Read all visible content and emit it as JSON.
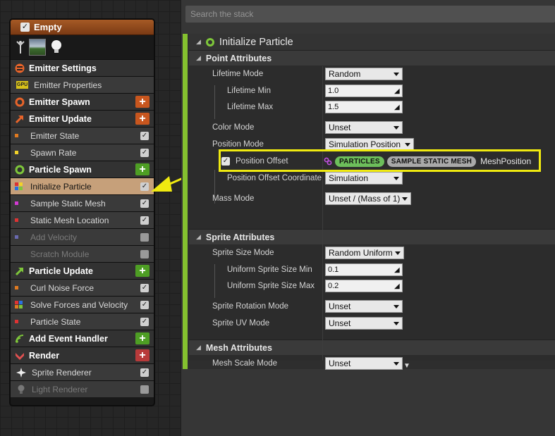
{
  "emitter": {
    "title": "Empty",
    "enabled": true,
    "icons": [
      "emitter-icon",
      "preview-thumbnail",
      "light-bulb-icon"
    ],
    "rows": [
      {
        "type": "category",
        "label": "Emitter Settings",
        "icon": "emitter-settings-icon",
        "color": "#e8642a"
      },
      {
        "type": "module",
        "label": "Emitter Properties",
        "badge": "GPU"
      },
      {
        "type": "category",
        "label": "Emitter Spawn",
        "icon": "emitter-spawn-icon",
        "color": "#e8642a",
        "add": true,
        "add_color": "#c8561e"
      },
      {
        "type": "category",
        "label": "Emitter Update",
        "icon": "emitter-update-icon",
        "color": "#e8642a",
        "add": true,
        "add_color": "#c8561e"
      },
      {
        "type": "module",
        "label": "Emitter State",
        "dots": [
          "#e07a20"
        ],
        "checked": true
      },
      {
        "type": "module",
        "label": "Spawn Rate",
        "dots": [
          "#f2d22a"
        ],
        "checked": true
      },
      {
        "type": "category",
        "label": "Particle Spawn",
        "icon": "particle-spawn-icon",
        "color": "#7ec63a",
        "add": true,
        "add_color": "#4e9e24"
      },
      {
        "type": "module",
        "label": "Initialize Particle",
        "dots": [
          "#d33",
          "#f2d22a",
          "#2a70e0",
          "#7ec63a"
        ],
        "checked": true,
        "selected": true
      },
      {
        "type": "module",
        "label": "Sample Static Mesh",
        "dots": [
          "#d33ad3"
        ],
        "checked": true
      },
      {
        "type": "module",
        "label": "Static Mesh Location",
        "dots": [
          "#d33"
        ],
        "checked": true
      },
      {
        "type": "module",
        "label": "Add Velocity",
        "dots": [
          "#6a6ab0"
        ],
        "checked": false,
        "disabled": true
      },
      {
        "type": "module",
        "label": "Scratch Module",
        "dots": [],
        "checked": false,
        "disabled": true
      },
      {
        "type": "category",
        "label": "Particle Update",
        "icon": "particle-update-icon",
        "color": "#7ec63a",
        "add": true,
        "add_color": "#4e9e24"
      },
      {
        "type": "module",
        "label": "Curl Noise Force",
        "dots": [
          "#e07a20"
        ],
        "checked": true
      },
      {
        "type": "module",
        "label": "Solve Forces and Velocity",
        "dots": [
          "#d33",
          "#2a70e0",
          "#e07a20",
          "#7ec63a"
        ],
        "checked": true
      },
      {
        "type": "module",
        "label": "Particle State",
        "dots": [
          "#d33"
        ],
        "checked": true
      },
      {
        "type": "category",
        "label": "Add Event Handler",
        "icon": "event-handler-icon",
        "color": "#7ec63a",
        "add": true,
        "add_color": "#4e9e24"
      },
      {
        "type": "category",
        "label": "Render",
        "icon": "render-icon",
        "color": "#e05050",
        "add": true,
        "add_color": "#b83a3a"
      },
      {
        "type": "module",
        "label": "Sprite Renderer",
        "icon": "sprite-icon",
        "checked": true
      },
      {
        "type": "module",
        "label": "Light Renderer",
        "icon": "light-icon",
        "checked": false,
        "disabled": true
      }
    ]
  },
  "search": {
    "placeholder": "Search the stack"
  },
  "module": {
    "title": "Initialize Particle",
    "sections": {
      "point": "Point Attributes",
      "sprite": "Sprite Attributes",
      "mesh": "Mesh Attributes"
    },
    "props": {
      "lifetime_mode": {
        "label": "Lifetime Mode",
        "value": "Random"
      },
      "lifetime_min": {
        "label": "Lifetime Min",
        "value": "1.0"
      },
      "lifetime_max": {
        "label": "Lifetime Max",
        "value": "1.5"
      },
      "color_mode": {
        "label": "Color Mode",
        "value": "Unset"
      },
      "position_mode": {
        "label": "Position Mode",
        "value": "Simulation Position"
      },
      "position_offset": {
        "label": "Position Offset",
        "checked": true,
        "pill1": "PARTICLES",
        "pill2": "SAMPLE STATIC MESH",
        "link": "MeshPosition"
      },
      "position_offset_coord": {
        "label": "Position Offset Coordinate",
        "value": "Simulation"
      },
      "mass_mode": {
        "label": "Mass Mode",
        "value": "Unset / (Mass of 1)"
      },
      "sprite_size_mode": {
        "label": "Sprite Size Mode",
        "value": "Random Uniform"
      },
      "uniform_sprite_min": {
        "label": "Uniform Sprite Size Min",
        "value": "0.1"
      },
      "uniform_sprite_max": {
        "label": "Uniform Sprite Size Max",
        "value": "0.2"
      },
      "sprite_rotation_mode": {
        "label": "Sprite Rotation Mode",
        "value": "Unset"
      },
      "sprite_uv_mode": {
        "label": "Sprite UV Mode",
        "value": "Unset"
      },
      "mesh_scale_mode": {
        "label": "Mesh Scale Mode",
        "value": "Unset"
      }
    }
  },
  "colors": {
    "highlight": "#f0ea10",
    "accent_green": "#84c12f",
    "pill1": "#6dbf5b",
    "pill2": "#a9a9a9",
    "link_icon": "#c050e0"
  }
}
